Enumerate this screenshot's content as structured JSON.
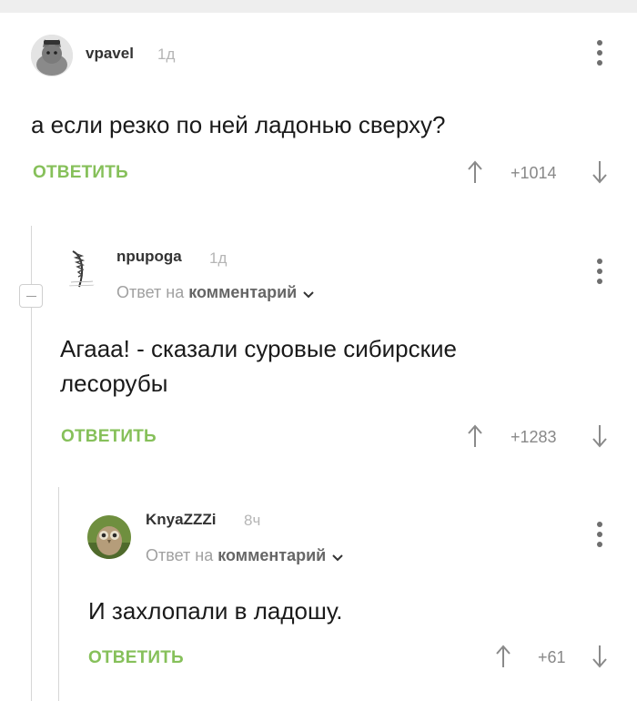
{
  "comments": [
    {
      "username": "vpavel",
      "time": "1д",
      "text": "а если резко по ней ладонью сверху?",
      "reply_label": "ОТВЕТИТЬ",
      "rating": "+1014"
    },
    {
      "username": "npupoga",
      "time": "1д",
      "reply_prefix": "Ответ на",
      "reply_target": "комментарий",
      "text_lines": [
        "Агааа! - сказали суровые сибирские",
        "лесорубы"
      ],
      "reply_label": "ОТВЕТИТЬ",
      "rating": "+1283"
    },
    {
      "username": "KnyaZZZi",
      "time": "8ч",
      "reply_prefix": "Ответ на",
      "reply_target": "комментарий",
      "text": "И захлопали в ладошу.",
      "reply_label": "ОТВЕТИТЬ",
      "rating": "+61"
    }
  ],
  "colors": {
    "accent": "#86c05a",
    "muted": "#b5b5b5",
    "thread_line": "#d6d6d6"
  }
}
